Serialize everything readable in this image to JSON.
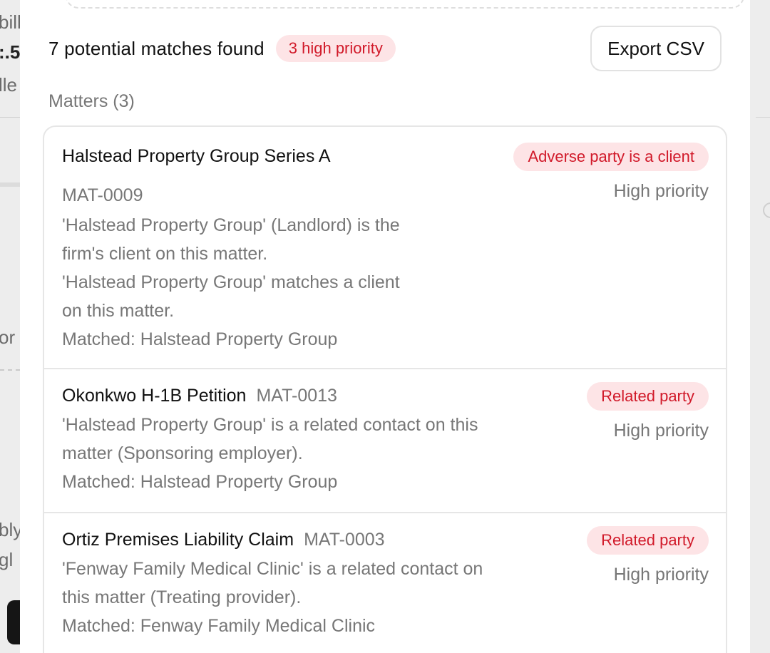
{
  "background": {
    "left_fragments": [
      "bill",
      ":.5",
      "lle",
      "or",
      "bly",
      "gl"
    ]
  },
  "summary": {
    "text": "7 potential matches found",
    "priority_pill": "3 high priority",
    "export_label": "Export CSV"
  },
  "section": {
    "label": "Matters (3)"
  },
  "matters": [
    {
      "title": "Halstead Property Group Series A",
      "code": "MAT-0009",
      "badge": "Adverse party is a client",
      "priority": "High priority",
      "lines": [
        "'Halstead Property Group' (Landlord) is the",
        "firm's client on this matter.",
        "'Halstead Property Group' matches a client",
        "on this matter.",
        "Matched: Halstead Property Group"
      ]
    },
    {
      "title": "Okonkwo H-1B Petition",
      "code": "MAT-0013",
      "badge": "Related party",
      "priority": "High priority",
      "lines": [
        "'Halstead Property Group' is a related contact on this",
        "matter (Sponsoring employer).",
        "Matched: Halstead Property Group"
      ]
    },
    {
      "title": "Ortiz Premises Liability Claim",
      "code": "MAT-0003",
      "badge": "Related party",
      "priority": "High priority",
      "lines": [
        "'Fenway Family Medical Clinic' is a related contact on",
        "this matter (Treating provider).",
        "Matched: Fenway Family Medical Clinic"
      ]
    }
  ],
  "colors": {
    "accent_red": "#d11a2a",
    "pill_bg": "#fde4e6",
    "muted_text": "#777777"
  }
}
